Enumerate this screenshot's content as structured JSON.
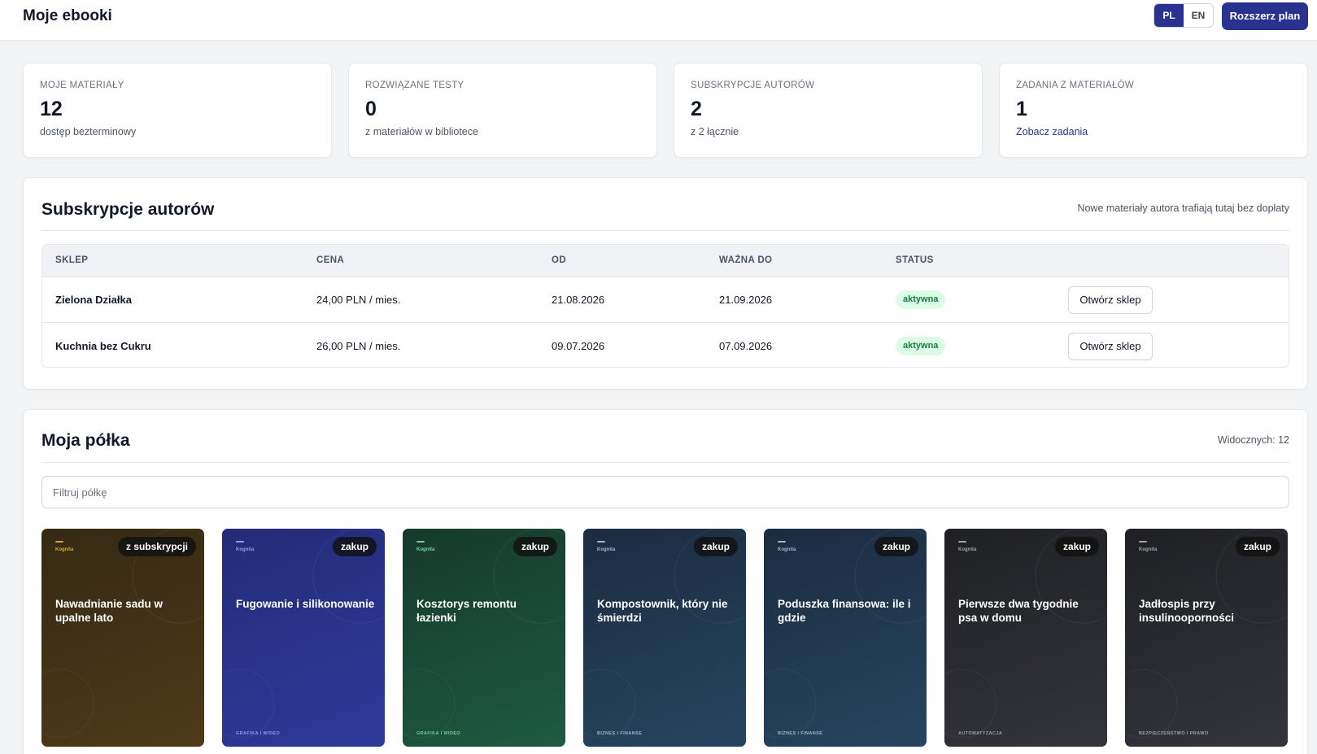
{
  "header": {
    "title": "Moje ebooki",
    "lang_pl": "PL",
    "lang_en": "EN",
    "upgrade_label": "Rozszerz plan"
  },
  "stats": [
    {
      "label": "MOJE MATERIAŁY",
      "value": "12",
      "sub": "dostęp bezterminowy"
    },
    {
      "label": "ROZWIĄZANE TESTY",
      "value": "0",
      "sub": "z materiałów w bibliotece"
    },
    {
      "label": "SUBSKRYPCJE AUTORÓW",
      "value": "2",
      "sub": "z 2 łącznie"
    },
    {
      "label": "ZADANIA Z MATERIAŁÓW",
      "value": "1",
      "sub": "Zobacz zadania"
    }
  ],
  "subscriptions": {
    "title": "Subskrypcje autorów",
    "note": "Nowe materiały autora trafiają tutaj bez dopłaty",
    "columns": [
      "SKLEP",
      "CENA",
      "OD",
      "WAŻNA DO",
      "STATUS"
    ],
    "rows": [
      {
        "shop": "Zielona Działka",
        "price": "24,00 PLN / mies.",
        "from": "21.08.2026",
        "until": "21.09.2026",
        "status": "aktywna",
        "action": "Otwórz sklep"
      },
      {
        "shop": "Kuchnia bez Cukru",
        "price": "26,00 PLN / mies.",
        "from": "09.07.2026",
        "until": "07.09.2026",
        "status": "aktywna",
        "action": "Otwórz sklep"
      }
    ]
  },
  "shelf": {
    "title": "Moja półka",
    "visible_count": "Widocznych: 12",
    "filter_placeholder": "Filtruj półkę",
    "books": [
      {
        "brand": "Kognita",
        "tag": "z subskrypcji",
        "title": "Nawadnianie sadu w upalne lato",
        "category": ""
      },
      {
        "brand": "Kognita",
        "tag": "zakup",
        "title": "Fugowanie i silikonowanie",
        "category": "GRAFIKA I WIDEO"
      },
      {
        "brand": "Kognita",
        "tag": "zakup",
        "title": "Kosztorys remontu łazienki",
        "category": "GRAFIKA I WIDEO"
      },
      {
        "brand": "Kognita",
        "tag": "zakup",
        "title": "Kompostownik, który nie śmierdzi",
        "category": "BIZNES I FINANSE"
      },
      {
        "brand": "Kognita",
        "tag": "zakup",
        "title": "Poduszka finansowa: ile i gdzie",
        "category": "BIZNES I FINANSE"
      },
      {
        "brand": "Kognita",
        "tag": "zakup",
        "title": "Pierwsze dwa tygodnie psa w domu",
        "category": "AUTOMATYZACJA"
      },
      {
        "brand": "Kognita",
        "tag": "zakup",
        "title": "Jadłospis przy insulinooporności",
        "category": "BEZPIECZEŃSTWO I PRAWO"
      }
    ]
  },
  "colors": {
    "primary": "#2a3290",
    "badge_bg": "#dcfce7",
    "badge_text": "#15803d",
    "book_gradients": [
      [
        "#352a14",
        "#4d3a18"
      ],
      [
        "#232c78",
        "#2e3a9a"
      ],
      [
        "#163a2c",
        "#1e5a42"
      ],
      [
        "#1c2c40",
        "#264560"
      ],
      [
        "#1c2c40",
        "#264560"
      ],
      [
        "#1f2024",
        "#34353b"
      ],
      [
        "#1f2024",
        "#34353b"
      ]
    ],
    "book_accents": [
      "#d4a93e",
      "#8aa0e8",
      "#7fc9a0",
      "#9fb6cf",
      "#9fb6cf",
      "#a1a1aa",
      "#a1a1aa"
    ]
  }
}
